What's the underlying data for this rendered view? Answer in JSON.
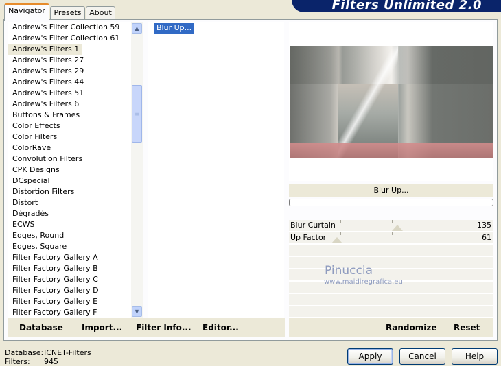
{
  "tabs": [
    "Navigator",
    "Presets",
    "About"
  ],
  "banner_title": "Filters Unlimited 2.0",
  "categories": [
    "Andrew's Filter Collection 59",
    "Andrew's Filter Collection 61",
    "Andrew's Filters 1",
    "Andrew's Filters 27",
    "Andrew's Filters 29",
    "Andrew's Filters 44",
    "Andrew's Filters 51",
    "Andrew's Filters 6",
    "Buttons & Frames",
    "Color Effects",
    "Color Filters",
    "ColorRave",
    "Convolution Filters",
    "CPK Designs",
    "DCspecial",
    "Distortion Filters",
    "Distort",
    "Dégradés",
    "ECWS",
    "Edges, Round",
    "Edges, Square",
    "Filter Factory Gallery A",
    "Filter Factory Gallery B",
    "Filter Factory Gallery C",
    "Filter Factory Gallery D",
    "Filter Factory Gallery E",
    "Filter Factory Gallery F"
  ],
  "selected_category": "Andrew's Filters 1",
  "filters": [
    "Blur Up..."
  ],
  "current_filter_name": "Blur Up...",
  "controls": [
    {
      "label": "Blur Curtain",
      "value": "135",
      "level": 135
    },
    {
      "label": "Up Factor",
      "value": "61",
      "level": 61
    }
  ],
  "watermark": {
    "line1": "Pinuccia",
    "line2": "www.maidiregrafica.eu"
  },
  "left_buttons": [
    "Database",
    "Import...",
    "Filter Info...",
    "Editor..."
  ],
  "right_buttons": [
    "Randomize",
    "Reset"
  ],
  "status": {
    "database_label": "Database:",
    "database_value": "ICNET-Filters",
    "filters_label": "Filters:",
    "filters_value": "945"
  },
  "dialog_buttons": {
    "apply": "Apply",
    "cancel": "Cancel",
    "help": "Help"
  }
}
